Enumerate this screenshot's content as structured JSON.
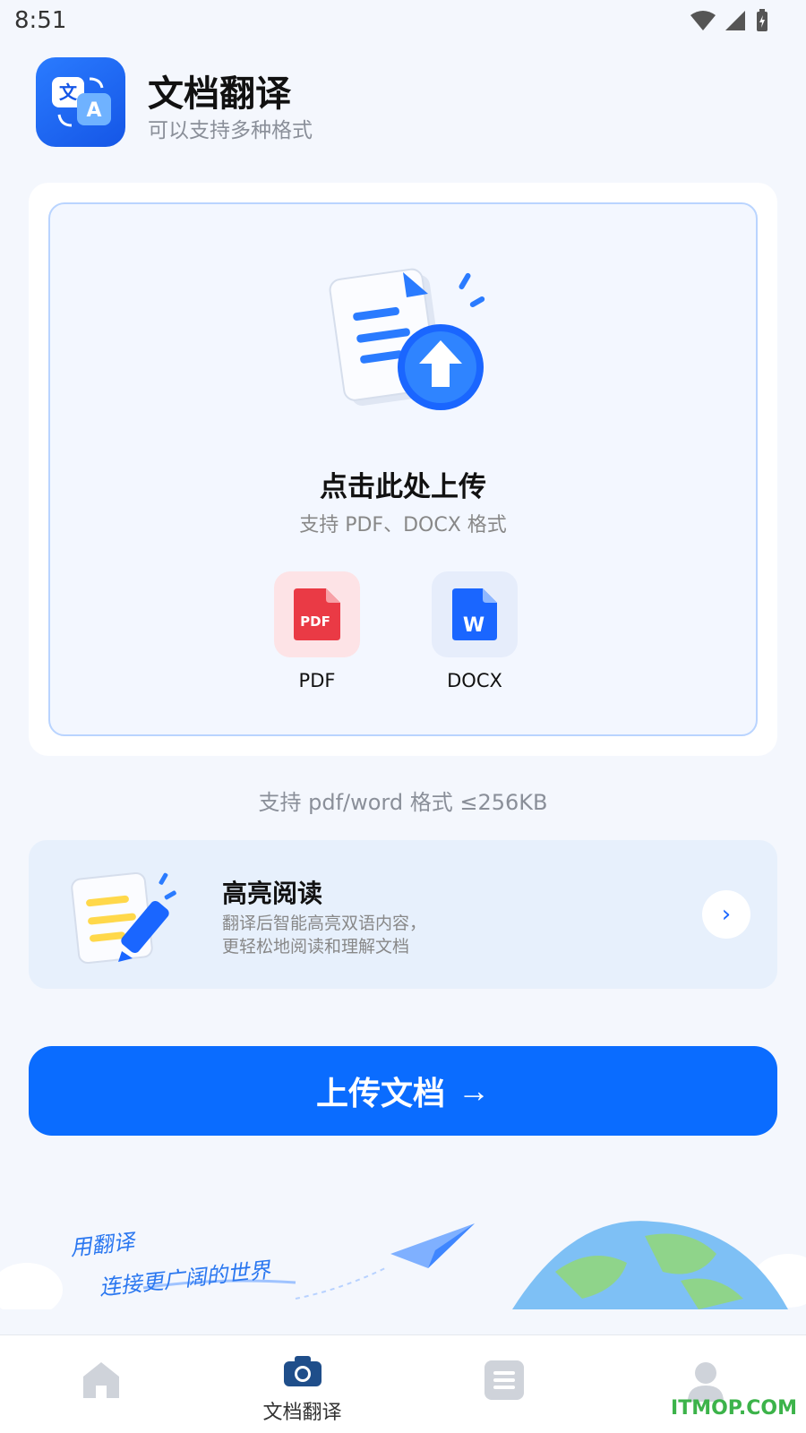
{
  "status_bar": {
    "time": "8:51"
  },
  "header": {
    "title": "文档翻译",
    "subtitle": "可以支持多种格式"
  },
  "upload": {
    "title": "点击此处上传",
    "hint": "支持 PDF、DOCX 格式",
    "formats": [
      {
        "label": "PDF",
        "icon_text": "PDF"
      },
      {
        "label": "DOCX",
        "icon_text": "W"
      }
    ]
  },
  "size_note": "支持 pdf/word 格式 ≤256KB",
  "highlight": {
    "title": "高亮阅读",
    "desc_line1": "翻译后智能高亮双语内容，",
    "desc_line2": "更轻松地阅读和理解文档",
    "arrow": "›"
  },
  "primary_button": {
    "label": "上传文档",
    "arrow": "→"
  },
  "banner": {
    "line1": "用翻译",
    "line2": "连接更广阔的世界"
  },
  "bottom_nav": {
    "items": [
      {
        "label": ""
      },
      {
        "label": "文档翻译"
      },
      {
        "label": ""
      },
      {
        "label": ""
      }
    ]
  },
  "watermark": "ITMOP.COM",
  "colors": {
    "primary": "#0a6cff",
    "background": "#f4f7fd",
    "pdf_red": "#ea3a45",
    "word_blue": "#1a66ff"
  }
}
